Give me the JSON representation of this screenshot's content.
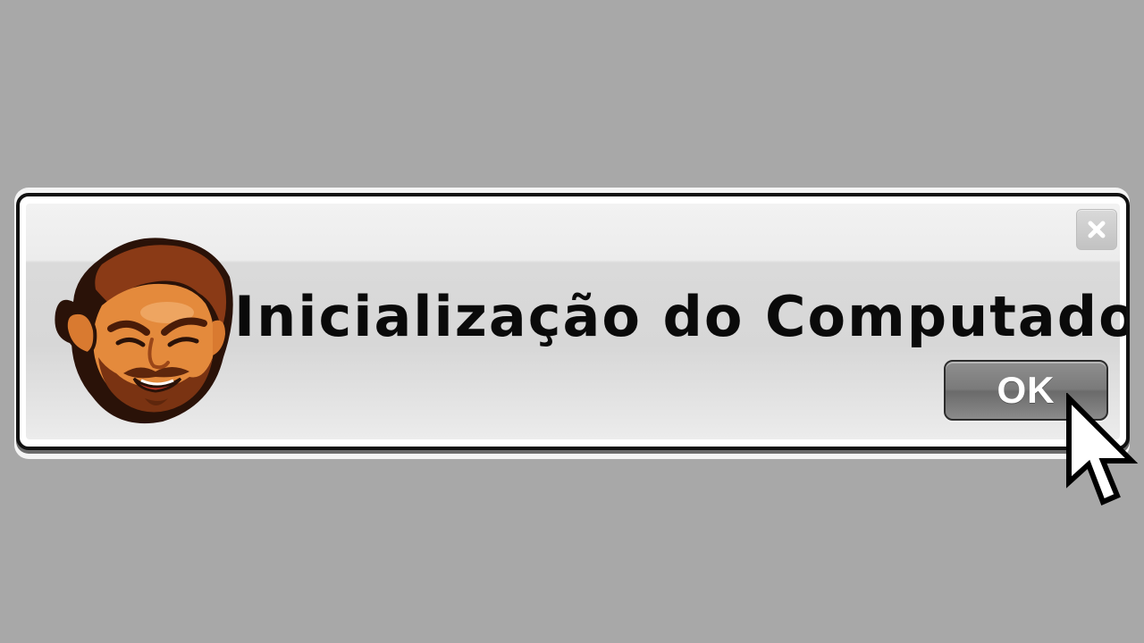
{
  "dialog": {
    "title": "Inicialização do Computador",
    "ok_label": "OK",
    "close_icon": "close-icon",
    "avatar_icon": "bearded-man-avatar",
    "cursor_icon": "mouse-pointer-icon"
  },
  "colors": {
    "background": "#a8a8a8",
    "dialog_border": "#111111",
    "title_text": "#0a0a0a",
    "ok_button": "#7a7a7a",
    "ok_text": "#ffffff"
  }
}
